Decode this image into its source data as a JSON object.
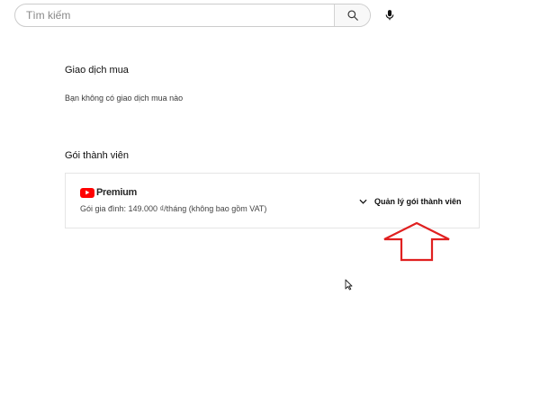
{
  "search": {
    "placeholder": "Tìm kiếm",
    "value": ""
  },
  "purchases": {
    "title": "Giao dịch mua",
    "empty_message": "Bạn không có giao dịch mua nào"
  },
  "memberships": {
    "title": "Gói thành viên",
    "premium_label": "Premium",
    "plan_text": "Gói gia đình: 149.000 ₫/tháng (không bao gồm VAT)",
    "manage_label": "Quản lý gói thành viên"
  },
  "colors": {
    "brand_red": "#ff0000",
    "annotation_red": "#e02020"
  },
  "icons": {
    "search": "search-icon",
    "mic": "mic-icon",
    "youtube": "youtube-logo-icon",
    "chevron": "chevron-down-icon",
    "arrow": "red-arrow-up-annotation",
    "cursor": "mouse-cursor-icon"
  }
}
